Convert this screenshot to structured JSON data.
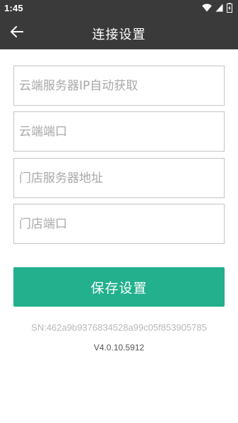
{
  "status_bar": {
    "time": "1:45",
    "icons": [
      "wifi-icon",
      "signal-icon",
      "battery-charging-icon"
    ]
  },
  "toolbar": {
    "back_icon": "arrow-left-icon",
    "title": "连接设置"
  },
  "form": {
    "cloud_server_ip": {
      "value": "",
      "placeholder": "云端服务器IP自动获取"
    },
    "cloud_port": {
      "value": "",
      "placeholder": "云端端口"
    },
    "store_server_address": {
      "value": "",
      "placeholder": "门店服务器地址"
    },
    "store_port": {
      "value": "",
      "placeholder": "门店端口"
    },
    "save_label": "保存设置"
  },
  "footer": {
    "sn": "SN:462a9b9376834528a99c05f853905785",
    "version": "V4.0.10.5912"
  },
  "colors": {
    "toolbar_bg": "#3a3a3a",
    "accent": "#22b08d",
    "field_border": "#c4c4c4",
    "placeholder": "#a8a8a8"
  }
}
